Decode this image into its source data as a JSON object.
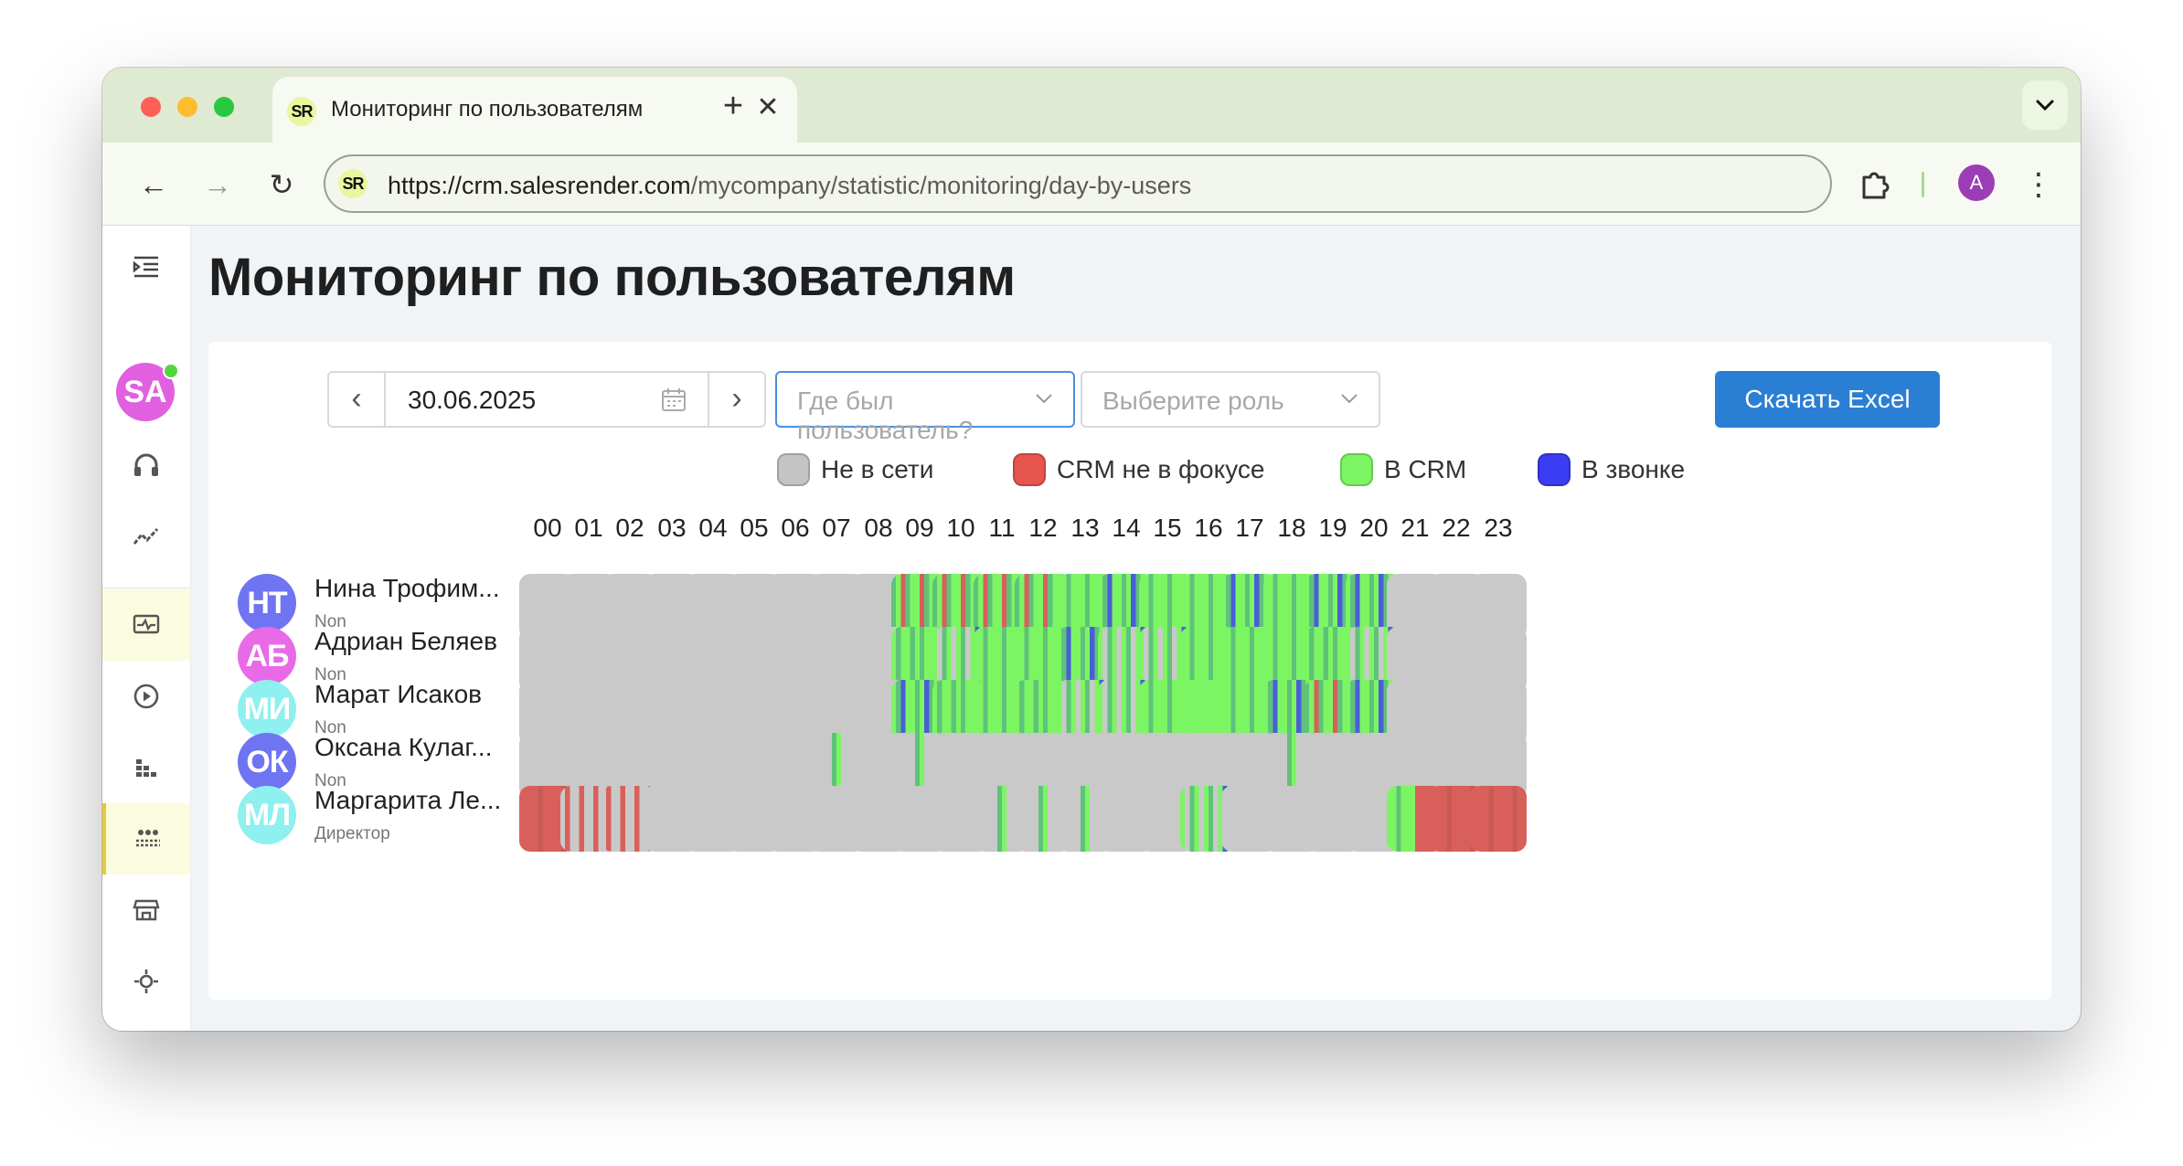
{
  "browser": {
    "tab_title": "Мониторинг по пользователям",
    "tab_close": "✕",
    "new_tab": "+",
    "favicon_text": "SR",
    "url_host": "https://crm.salesrender.com",
    "url_path": "/mycompany/statistic/monitoring/day-by-users",
    "profile_letter": "A",
    "back": "←",
    "forward": "→",
    "reload": "↻",
    "menu": "⋮",
    "tab_menu": "⌄"
  },
  "sidebar": {
    "avatar_initials": "SA",
    "items": [
      {
        "icon": "menu-indent-icon"
      },
      {
        "icon": "headset-icon"
      },
      {
        "icon": "trending-chart-icon"
      },
      {
        "icon": "monitor-pulse-icon"
      },
      {
        "icon": "play-circle-icon"
      },
      {
        "icon": "bar-blocks-icon"
      },
      {
        "icon": "users-grid-icon"
      },
      {
        "icon": "store-icon"
      },
      {
        "icon": "settings-icon"
      }
    ]
  },
  "page": {
    "title": "Мониторинг по пользователям"
  },
  "filters": {
    "date": "30.06.2025",
    "prev": "‹",
    "next": "›",
    "location_placeholder": "Где был пользователь?",
    "role_placeholder": "Выберите роль",
    "excel_button": "Скачать Excel"
  },
  "legend": [
    {
      "label": "Не в сети",
      "color": "#c4c4c4"
    },
    {
      "label": "CRM не в фокусе",
      "color": "#e8544e"
    },
    {
      "label": "В CRM",
      "color": "#7cf562"
    },
    {
      "label": "В звонке",
      "color": "#3b3df2"
    }
  ],
  "hours": [
    "00",
    "01",
    "02",
    "03",
    "04",
    "05",
    "06",
    "07",
    "08",
    "09",
    "10",
    "11",
    "12",
    "13",
    "14",
    "15",
    "16",
    "17",
    "18",
    "19",
    "20",
    "21",
    "22",
    "23"
  ],
  "users": [
    {
      "initials": "НТ",
      "name": "Нина Трофим...",
      "role": "Non",
      "avatar_color": "#6f74f2"
    },
    {
      "initials": "АБ",
      "name": "Адриан Беляев",
      "role": "Non",
      "avatar_color": "#e86ae6"
    },
    {
      "initials": "МИ",
      "name": "Марат Исаков",
      "role": "Non",
      "avatar_color": "#8ef0ef"
    },
    {
      "initials": "ОК",
      "name": "Оксана Кулаг...",
      "role": "Non",
      "avatar_color": "#6f74f2"
    },
    {
      "initials": "МЛ",
      "name": "Маргарита Ле...",
      "role": "Директор",
      "avatar_color": "#8ef0ef"
    }
  ],
  "activity": [
    [
      "off",
      "off",
      "off",
      "off",
      "off",
      "off",
      "off",
      "off",
      "off",
      "mix-gr",
      "mix-gr",
      "mix-gr",
      "mix-gr",
      "green",
      "mix-gb",
      "green",
      "green",
      "mix-gb",
      "green",
      "mix-gb",
      "mix-gb",
      "off",
      "off",
      "off"
    ],
    [
      "off",
      "off",
      "off",
      "off",
      "off",
      "off",
      "off",
      "off",
      "off",
      "mix-g",
      "mix-g-off",
      "green",
      "green",
      "mix-gb",
      "mix-g-off",
      "mix-g-off",
      "green",
      "green",
      "green",
      "mix-g",
      "mix-g-off",
      "off",
      "off",
      "off"
    ],
    [
      "off",
      "off",
      "off",
      "off",
      "off",
      "off",
      "off",
      "off",
      "off",
      "mix-gb",
      "mix-g",
      "green",
      "mix-g",
      "mix-g-off",
      "mix-g-off",
      "green",
      "green-solid",
      "green",
      "mix-gb",
      "mix-gr",
      "mix-gb",
      "off",
      "off",
      "off"
    ],
    [
      "off",
      "off",
      "off",
      "off",
      "off",
      "off",
      "off",
      "off-g",
      "off",
      "off-g",
      "off",
      "off",
      "off",
      "off",
      "off",
      "off",
      "off",
      "off",
      "off-g",
      "off",
      "off",
      "off",
      "off",
      "off"
    ],
    [
      "red",
      "off-r",
      "off-r",
      "off",
      "off",
      "off",
      "off",
      "off",
      "off",
      "off",
      "off",
      "off-g",
      "off-g",
      "off-g",
      "off",
      "off",
      "mix-g-off",
      "off",
      "off",
      "off",
      "off",
      "green-red",
      "red",
      "red"
    ]
  ]
}
